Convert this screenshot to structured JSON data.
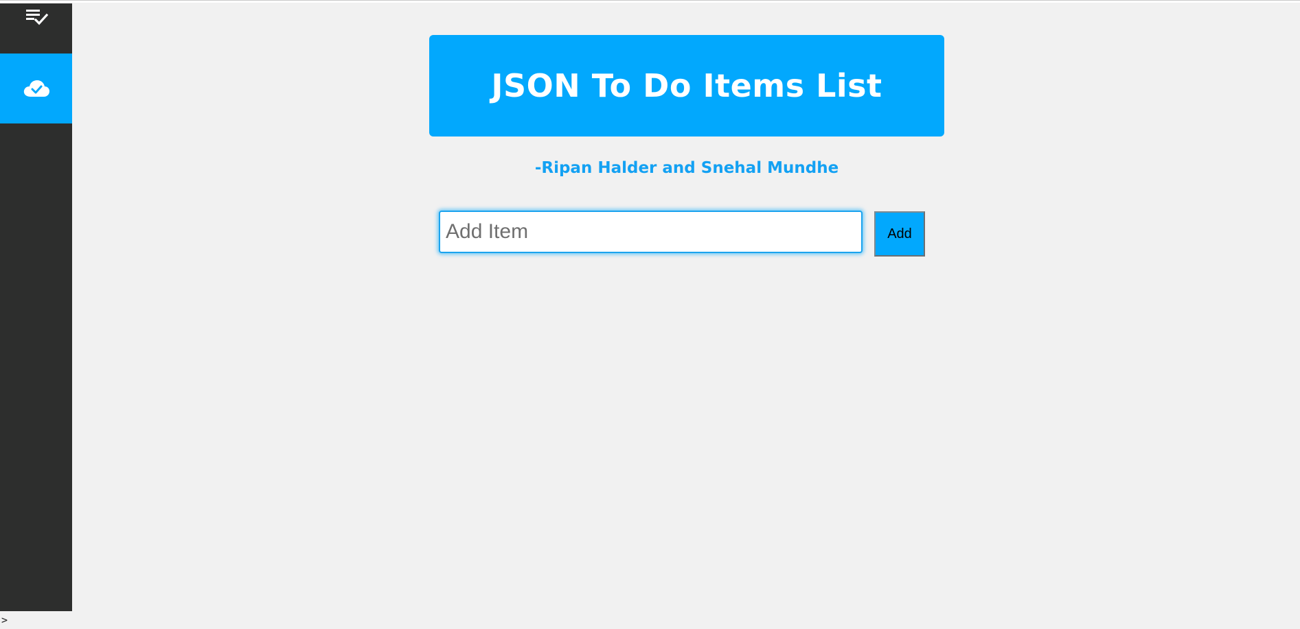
{
  "sidebar": {
    "items": [
      {
        "icon": "playlist-check-icon",
        "active": false
      },
      {
        "icon": "cloud-check-icon",
        "active": true
      }
    ]
  },
  "header": {
    "title": "JSON To Do Items List"
  },
  "author": {
    "text": "-Ripan Halder and Snehal Mundhe"
  },
  "add_item": {
    "placeholder": "Add Item",
    "value": "",
    "button_label": "Add"
  },
  "console": {
    "prompt": ">"
  },
  "colors": {
    "accent": "#02a8fd",
    "sidebar_bg": "#2d2e2d",
    "page_bg": "#f1f1f1",
    "author_text": "#13a1f3"
  }
}
